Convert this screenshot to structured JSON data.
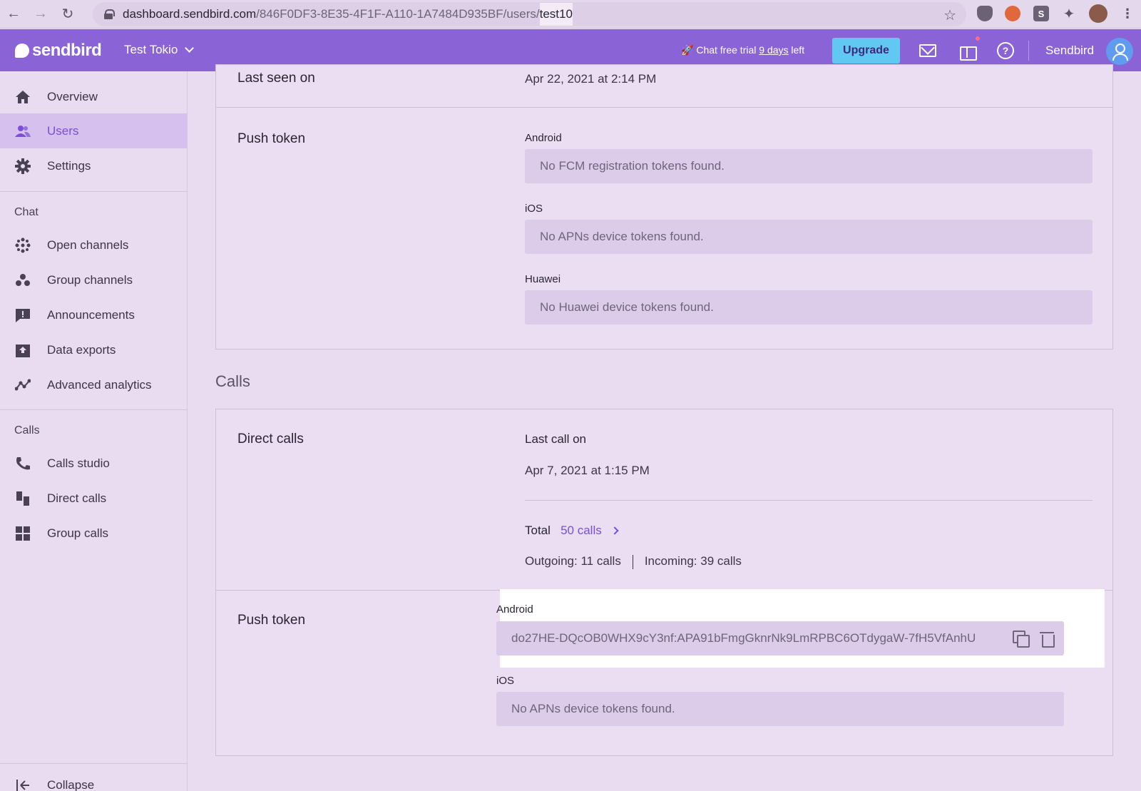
{
  "browser": {
    "url_host": "dashboard.sendbird.com",
    "url_path": "/846F0DF3-8E35-4F1F-A110-1A7484D935BF/users/",
    "url_highlight": "test10"
  },
  "header": {
    "logo": "sendbird",
    "app_name": "Test Tokio",
    "trial_prefix": "Chat free trial",
    "trial_link": "9 days",
    "trial_suffix": "left",
    "upgrade_label": "Upgrade",
    "help_glyph": "?",
    "org_name": "Sendbird"
  },
  "sidebar": {
    "items_top": [
      {
        "label": "Overview",
        "icon": "home-icon"
      },
      {
        "label": "Users",
        "icon": "users-icon"
      },
      {
        "label": "Settings",
        "icon": "gear-icon"
      }
    ],
    "chat_group": "Chat",
    "chat_items": [
      {
        "label": "Open channels",
        "icon": "open-channels-icon"
      },
      {
        "label": "Group channels",
        "icon": "group-channels-icon"
      },
      {
        "label": "Announcements",
        "icon": "announcement-icon"
      },
      {
        "label": "Data exports",
        "icon": "export-icon"
      },
      {
        "label": "Advanced analytics",
        "icon": "analytics-icon"
      }
    ],
    "calls_group": "Calls",
    "calls_items": [
      {
        "label": "Calls studio",
        "icon": "phone-icon"
      },
      {
        "label": "Direct calls",
        "icon": "direct-calls-icon"
      },
      {
        "label": "Group calls",
        "icon": "grid-icon"
      }
    ],
    "collapse_label": "Collapse"
  },
  "main": {
    "last_seen": {
      "label": "Last seen on",
      "value": "Apr 22, 2021 at 2:14 PM"
    },
    "chat_push": {
      "label": "Push token",
      "android_label": "Android",
      "android_value": "No FCM registration tokens found.",
      "ios_label": "iOS",
      "ios_value": "No APNs device tokens found.",
      "huawei_label": "Huawei",
      "huawei_value": "No Huawei device tokens found."
    },
    "calls_title": "Calls",
    "direct_calls": {
      "label": "Direct calls",
      "last_call_label": "Last call on",
      "last_call_value": "Apr 7, 2021 at 1:15 PM",
      "total_label": "Total",
      "total_link": "50 calls",
      "outgoing": "Outgoing: 11 calls",
      "incoming": "Incoming: 39 calls"
    },
    "calls_push": {
      "label": "Push token",
      "android_label": "Android",
      "android_value": "do27HE-DQcOB0WHX9cY3nf:APA91bFmgGknrNk9LmRPBC6OTdygaW-7fH5VfAnhU",
      "ios_label": "iOS",
      "ios_value": "No APNs device tokens found."
    }
  },
  "colors": {
    "header_bg": "#8a64d6",
    "accent": "#7a4fd6",
    "upgrade_bg": "#61c8f2",
    "page_bg": "#e9dcf0"
  }
}
